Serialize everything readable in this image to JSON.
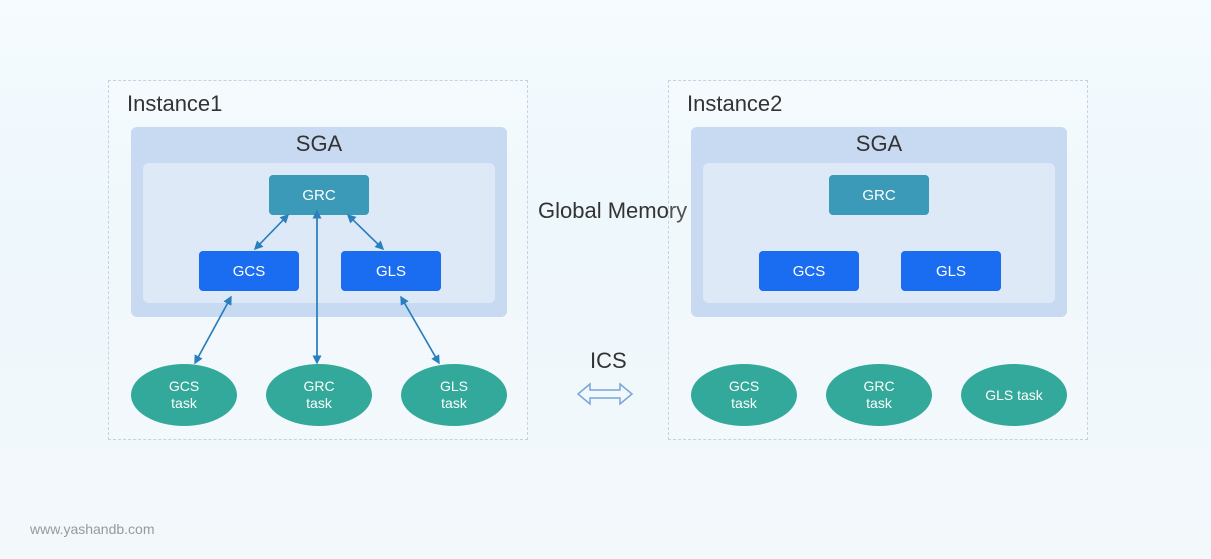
{
  "instance1": {
    "title": "Instance1",
    "sga_title": "SGA",
    "grc": "GRC",
    "gcs": "GCS",
    "gls": "GLS",
    "tasks": {
      "gcs": "GCS\ntask",
      "grc": "GRC\ntask",
      "gls": "GLS\ntask"
    }
  },
  "instance2": {
    "title": "Instance2",
    "sga_title": "SGA",
    "grc": "GRC",
    "gcs": "GCS",
    "gls": "GLS",
    "tasks": {
      "gcs": "GCS\ntask",
      "grc": "GRC\ntask",
      "gls": "GLS task"
    }
  },
  "global_memory_label": "Global Memory",
  "ics_label": "ICS",
  "footer_url": "www.yashandb.com"
}
